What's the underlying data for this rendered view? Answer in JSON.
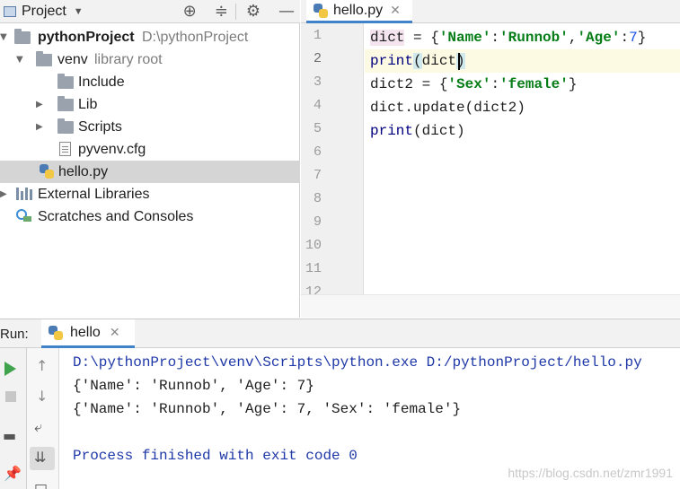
{
  "project_panel": {
    "title": "Project",
    "tools": [
      "target-icon",
      "collapse-icon",
      "gear-icon",
      "minimize-icon"
    ],
    "tree": [
      {
        "label": "pythonProject",
        "path": "D:\\pythonProject"
      },
      {
        "label": "venv",
        "note": "library root"
      },
      {
        "label": "Include"
      },
      {
        "label": "Lib"
      },
      {
        "label": "Scripts"
      },
      {
        "label": "pyvenv.cfg"
      },
      {
        "label": "hello.py"
      },
      {
        "label": "External Libraries"
      },
      {
        "label": "Scratches and Consoles"
      }
    ]
  },
  "editor": {
    "tab": {
      "label": "hello.py"
    },
    "line_numbers": [
      "1",
      "2",
      "3",
      "4",
      "5",
      "6",
      "7",
      "8",
      "9",
      "10",
      "11",
      "12"
    ],
    "current_line": 2
  },
  "run_panel": {
    "label": "Run:",
    "tab": {
      "label": "hello"
    },
    "output": [
      "D:\\pythonProject\\venv\\Scripts\\python.exe D:/pythonProject/hello.py",
      "{'Name': 'Runnob', 'Age': 7}",
      "{'Name': 'Runnob', 'Age': 7, 'Sex': 'female'}",
      "",
      "Process finished with exit code 0"
    ]
  },
  "watermark": "https://blog.csdn.net/zmr1991",
  "colors": {
    "accent": "#4083c9",
    "selection": "#d5d5d5",
    "string": "#067d17",
    "number": "#1750eb",
    "console_blue": "#1f38a8"
  }
}
